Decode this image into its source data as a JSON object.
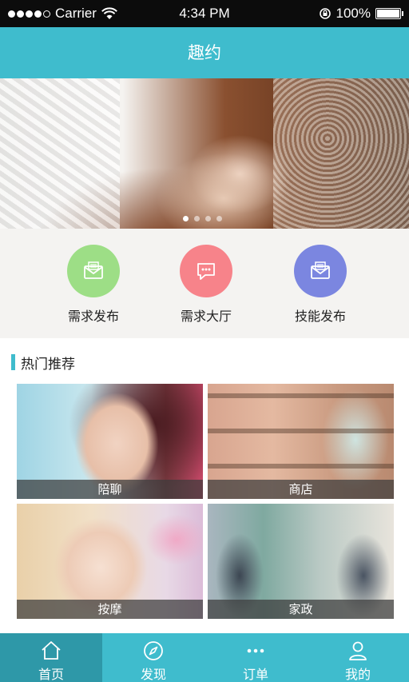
{
  "status_bar": {
    "carrier": "Carrier",
    "time": "4:34 PM",
    "battery": "100%"
  },
  "header": {
    "title": "趣约"
  },
  "banner": {
    "pages": 4,
    "active_page": 1
  },
  "actions": [
    {
      "label": "需求发布",
      "icon": "mail-icon",
      "color": "#9dde86"
    },
    {
      "label": "需求大厅",
      "icon": "chat-icon",
      "color": "#f7838a"
    },
    {
      "label": "技能发布",
      "icon": "mail-icon",
      "color": "#7b86e0"
    }
  ],
  "hot": {
    "title": "热门推荐",
    "items": [
      {
        "label": "陪聊"
      },
      {
        "label": "商店"
      },
      {
        "label": "按摩"
      },
      {
        "label": "家政"
      }
    ]
  },
  "tabs": [
    {
      "label": "首页",
      "icon": "home-icon",
      "active": true
    },
    {
      "label": "发现",
      "icon": "compass-icon",
      "active": false
    },
    {
      "label": "订单",
      "icon": "more-dots-icon",
      "active": false
    },
    {
      "label": "我的",
      "icon": "user-icon",
      "active": false
    }
  ],
  "colors": {
    "accent": "#3fbccd",
    "accent_dark": "#2e98a8"
  }
}
